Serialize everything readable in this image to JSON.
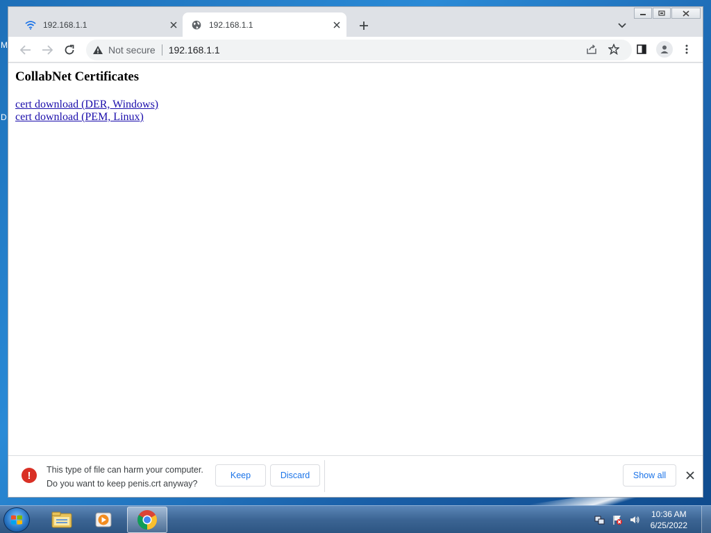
{
  "desktop": {
    "edge_letters": [
      "M",
      "D"
    ]
  },
  "browser": {
    "tabs": [
      {
        "title": "192.168.1.1",
        "favicon": "wifi-icon",
        "active": false
      },
      {
        "title": "192.168.1.1",
        "favicon": "globe-icon",
        "active": true
      }
    ],
    "address": {
      "security_label": "Not secure",
      "url": "192.168.1.1"
    }
  },
  "page": {
    "heading": "CollabNet Certificates",
    "links": [
      {
        "label": "cert download (DER, Windows)"
      },
      {
        "label": "cert download (PEM, Linux)"
      }
    ]
  },
  "download_bar": {
    "warning_line1": "This type of file can harm your computer.",
    "warning_line2": "Do you want to keep penis.crt anyway?",
    "keep_label": "Keep",
    "discard_label": "Discard",
    "show_all_label": "Show all"
  },
  "taskbar": {
    "apps": [
      "explorer-icon",
      "media-player-icon",
      "chrome-icon"
    ],
    "time": "10:36 AM",
    "date": "6/25/2022"
  },
  "colors": {
    "link": "#1a0dab",
    "accent_blue": "#1a73e8",
    "warning_red": "#d93025"
  }
}
